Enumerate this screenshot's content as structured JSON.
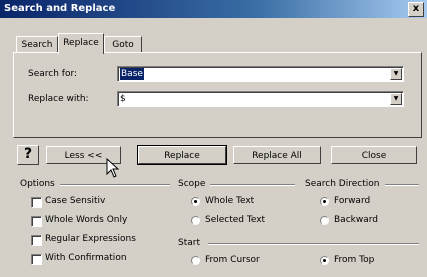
{
  "window": {
    "title": "Search and Replace",
    "close_glyph": "x"
  },
  "tabs": [
    {
      "label": "Search",
      "active": false
    },
    {
      "label": "Replace",
      "active": true
    },
    {
      "label": "Goto",
      "active": false
    }
  ],
  "search": {
    "label": "Search for:",
    "value": "Base"
  },
  "replace": {
    "label": "Replace with:",
    "value": "$"
  },
  "buttons": {
    "help": "?",
    "less": "Less <<",
    "replace": "Replace",
    "replace_all": "Replace All",
    "close": "Close"
  },
  "options": {
    "title": "Options",
    "items": [
      {
        "label": "Case Sensitiv",
        "checked": false
      },
      {
        "label": "Whole Words Only",
        "checked": false
      },
      {
        "label": "Regular Expressions",
        "checked": false
      },
      {
        "label": "With Confirmation",
        "checked": false
      }
    ]
  },
  "scope": {
    "title": "Scope",
    "items": [
      {
        "label": "Whole Text",
        "selected": true
      },
      {
        "label": "Selected Text",
        "selected": false
      }
    ]
  },
  "direction": {
    "title": "Search Direction",
    "items": [
      {
        "label": "Forward",
        "selected": true
      },
      {
        "label": "Backward",
        "selected": false
      }
    ]
  },
  "start": {
    "title": "Start",
    "items": [
      {
        "label": "From Cursor",
        "selected": false
      },
      {
        "label": "From Top",
        "selected": true
      }
    ]
  },
  "icons": {
    "cursor": "mouse-pointer-icon"
  }
}
